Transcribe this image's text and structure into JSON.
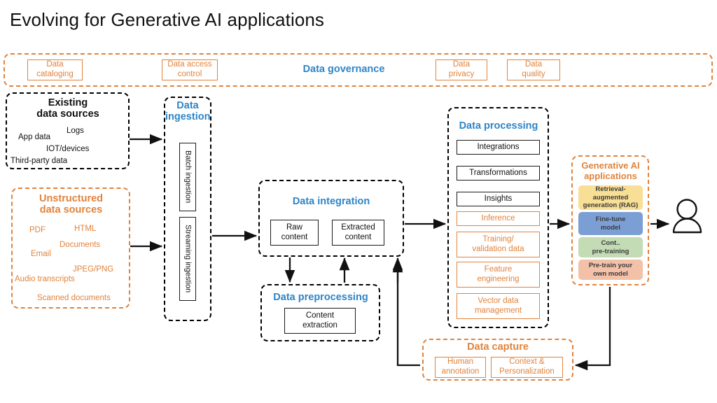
{
  "title": "Evolving for Generative AI applications",
  "governance": {
    "heading": "Data governance",
    "items": [
      {
        "label": "Data\ncataloging"
      },
      {
        "label": "Data access\ncontrol"
      },
      {
        "label": "Data\nprivacy"
      },
      {
        "label": "Data\nquality"
      }
    ]
  },
  "existing_sources": {
    "heading": "Existing\ndata sources",
    "items": [
      "Logs",
      "App data",
      "IOT/devices",
      "Third-party data"
    ]
  },
  "unstructured_sources": {
    "heading": "Unstructured\ndata sources",
    "items": [
      "PDF",
      "HTML",
      "Documents",
      "Email",
      "JPEG/PNG",
      "Audio transcripts",
      "Scanned documents"
    ]
  },
  "ingestion": {
    "heading": "Data\ningestion",
    "items": [
      "Batch ingestion",
      "Streaming ingestion"
    ]
  },
  "integration": {
    "heading": "Data integration",
    "items": [
      "Raw\ncontent",
      "Extracted\ncontent"
    ]
  },
  "preprocessing": {
    "heading": "Data preprocessing",
    "items": [
      "Content\nextraction"
    ]
  },
  "processing": {
    "heading": "Data processing",
    "items": [
      {
        "label": "Integrations",
        "style": "black"
      },
      {
        "label": "Transformations",
        "style": "black"
      },
      {
        "label": "Insights",
        "style": "black"
      },
      {
        "label": "Inference",
        "style": "orange"
      },
      {
        "label": "Training/\nvalidation data",
        "style": "orange"
      },
      {
        "label": "Feature\nengineering",
        "style": "orange"
      },
      {
        "label": "Vector data\nmanagement",
        "style": "orange"
      }
    ]
  },
  "genai": {
    "heading": "Generative AI\napplications",
    "items": [
      {
        "label": "Retrieval-\naugmented\ngeneration (RAG)",
        "color": "#F8DF95"
      },
      {
        "label": "Fine-tune\nmodel",
        "color": "#7B9FD4"
      },
      {
        "label": "Cont..\npre-training",
        "color": "#C3DCB5"
      },
      {
        "label": "Pre-train your\nown model",
        "color": "#F3C0A8"
      }
    ]
  },
  "capture": {
    "heading": "Data capture",
    "items": [
      "Human\nannotation",
      "Context &\nPersonalization"
    ]
  },
  "end_user": {
    "icon": "user-icon"
  },
  "colors": {
    "accent_blue": "#2E85C8",
    "accent_orange": "#E1833C",
    "line": "#111111"
  }
}
